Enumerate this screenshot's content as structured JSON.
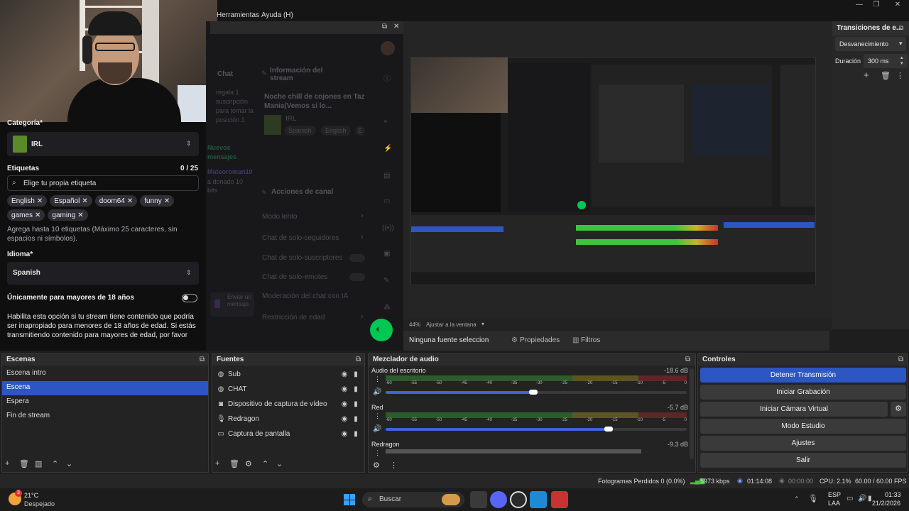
{
  "menu": {
    "items": [
      "Herramientas",
      "Ayuda (H)"
    ]
  },
  "stream_info": {
    "category_label": "Categoría*",
    "category_value": "IRL",
    "tags_label": "Etiquetas",
    "tags_count": "0 / 25",
    "tags_placeholder": "Elige tu propia etiqueta",
    "tags": [
      "English",
      "Español",
      "doom64",
      "funny",
      "games",
      "gaming"
    ],
    "tags_hint": "Agrega hasta 10 etiquetas (Máximo 25 caracteres, sin espacios ni símbolos).",
    "language_label": "Idioma*",
    "language_value": "Spanish",
    "mature_label": "Únicamente para mayores de 18 años",
    "mature_desc": "Habilita esta opción si tu stream tiene contenido que podría ser inapropiado para menores de 18 años de edad. Si estás transmitiendo contenido para mayores de edad, por favor"
  },
  "dock": {
    "chat_title": "Chat",
    "chat_gift": "regala 1 suscripción para tomar la posición 1",
    "new_messages": "Nuevos mensajes",
    "donor": "Mateoroman10",
    "donated": "a donado 10 bits",
    "info_title": "Información del stream",
    "stream_title": "Noche chill de cojones en Taz Mania(Vemos si lo...",
    "stream_cat": "IRL",
    "stream_tags": [
      "Spanish",
      "English",
      "E"
    ],
    "actions_title": "Acciones de canal",
    "actions": [
      "Modo lento",
      "Chat de solo-seguidores",
      "Chat de solo-suscriptores",
      "Chat de solo-emotes",
      "Moderación del chat con IA",
      "Restricción de edad"
    ],
    "send_placeholder": "Enviar un mensaje"
  },
  "preview": {
    "zoom": "44%",
    "fit_label": "Ajustar a la ventana"
  },
  "source_bar": {
    "no_source": "Ninguna fuente seleccionada",
    "properties": "Propiedades",
    "filters": "Filtros"
  },
  "transitions": {
    "title": "Transiciones de e...",
    "selected": "Desvanecimiento",
    "duration_label": "Duración",
    "duration_value": "300 ms"
  },
  "scenes": {
    "title": "Escenas",
    "items": [
      "Escena intro",
      "Escena",
      "Espera",
      "Fin de stream"
    ],
    "selected_index": 1
  },
  "sources": {
    "title": "Fuentes",
    "items": [
      {
        "name": "Sub",
        "icon": "globe-icon"
      },
      {
        "name": "CHAT",
        "icon": "globe-icon"
      },
      {
        "name": "Dispositivo de captura de vídeo",
        "icon": "camera-icon"
      },
      {
        "name": "Redragon",
        "icon": "microphone-icon"
      },
      {
        "name": "Captura de pantalla",
        "icon": "monitor-icon"
      }
    ]
  },
  "mixer": {
    "title": "Mezclador de audio",
    "channels": [
      {
        "name": "Audio del escritorio",
        "db": "-18.6 dB",
        "level": 0.55,
        "volume": 0.49
      },
      {
        "name": "Red",
        "db": "-5.7 dB",
        "level": 0.78,
        "volume": 0.74
      },
      {
        "name": "Redragon",
        "db": "-9.3 dB",
        "level": 0.0,
        "volume": 0.0
      }
    ],
    "ticks": [
      "-60",
      "-55",
      "-50",
      "-45",
      "-40",
      "-35",
      "-30",
      "-25",
      "-20",
      "-15",
      "-10",
      "-5",
      "0"
    ]
  },
  "controls": {
    "title": "Controles",
    "buttons": [
      "Detener Transmisión",
      "Iniciar Grabación",
      "Iniciar Cámara Virtual",
      "Modo Estudio",
      "Ajustes",
      "Salir"
    ]
  },
  "status": {
    "dropped": "Fotogramas Perdidos 0 (0.0%)",
    "bitrate": "5973 kbps",
    "live_time": "01:14:08",
    "rec_time": "00:00:00",
    "cpu": "CPU: 2.1%",
    "fps": "60.00 / 60.00 FPS"
  },
  "taskbar": {
    "temp": "21°C",
    "weather": "Despejado",
    "weather_badge": "3",
    "search": "Buscar",
    "lang": "ESP",
    "lang_sub": "LAA",
    "time": "01:33",
    "date": "21/2/2026"
  },
  "colors": {
    "accent": "#2c56c2",
    "meter_green": "#3ec43e",
    "meter_yellow": "#c9b32a",
    "meter_red": "#c83232",
    "twitch_purple": "#9147ff",
    "green_btn": "#00c853"
  }
}
